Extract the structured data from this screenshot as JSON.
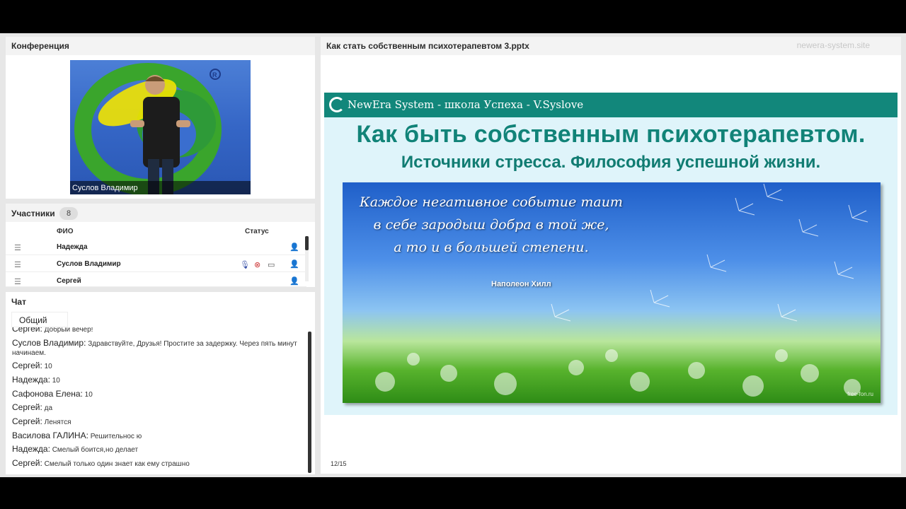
{
  "conference": {
    "title": "Конференция",
    "video_name": "Суслов Владимир"
  },
  "participants": {
    "title": "Участники",
    "count": "8",
    "col_name": "ФИО",
    "col_status": "Статус",
    "rows": [
      {
        "name": "Надежда"
      },
      {
        "name": "Суслов Владимир"
      },
      {
        "name": "Сергей"
      }
    ]
  },
  "chat": {
    "title": "Чат",
    "tab": "Общий",
    "messages": [
      {
        "author": "Сергей:",
        "text": "Добрый вечер!"
      },
      {
        "author": "Суслов Владимир:",
        "text": "Здравствуйте, Друзья! Простите за задержку. Через пять минут начинаем."
      },
      {
        "author": "Сергей:",
        "text": "10"
      },
      {
        "author": "Надежда:",
        "text": "10"
      },
      {
        "author": "Сафонова Елена:",
        "text": "10"
      },
      {
        "author": "Сергей:",
        "text": "да"
      },
      {
        "author": "Сергей:",
        "text": "Ленятся"
      },
      {
        "author": "Василова  ГАЛИНА:",
        "text": "Решительнос  ю"
      },
      {
        "author": "Надежда:",
        "text": "Смелый боится,но делает"
      },
      {
        "author": "Сергей:",
        "text": "Смелый только один знает как ему страшно"
      }
    ]
  },
  "presentation": {
    "title": "Как стать собственным психотерапевтом 3.pptx",
    "watermark": "newera-system.site",
    "page": "12/15",
    "slide": {
      "brand": "NewEra System - школа Успеха - V.Syslove",
      "title": "Как быть собственным психотерапевтом.",
      "subtitle": "Источники стресса. Философия успешной жизни.",
      "quote_lines": [
        "Каждое негативное событие таит",
        "в себе зародыш добра в той же,",
        "а то и в большей степени."
      ],
      "quote_author": "Наполеон Хилл",
      "image_credit": "free-fon.ru"
    }
  },
  "colors": {
    "teal": "#12877b",
    "slide_text": "#118378"
  }
}
